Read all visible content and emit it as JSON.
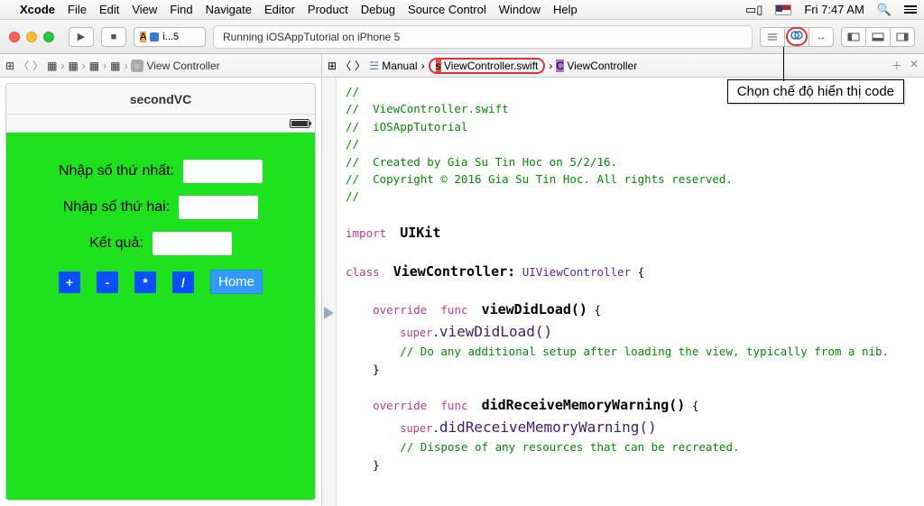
{
  "menubar": {
    "app": "Xcode",
    "items": [
      "File",
      "Edit",
      "View",
      "Find",
      "Navigate",
      "Editor",
      "Product",
      "Debug",
      "Source Control",
      "Window",
      "Help"
    ],
    "time": "Fri 7:47 AM"
  },
  "toolbar": {
    "scheme": "i...5",
    "status": "Running iOSAppTutorial on iPhone 5"
  },
  "left_jump": {
    "item": "View Controller"
  },
  "editor_jump": {
    "mode": "Manual",
    "file": "ViewController.swift",
    "class": "ViewController"
  },
  "phone": {
    "title": "secondVC",
    "label1": "Nhập số thứ nhất:",
    "label2": "Nhập số thứ hai:",
    "label3": "Kết quả:",
    "btn_plus": "+",
    "btn_minus": "-",
    "btn_mul": "*",
    "btn_div": "/",
    "btn_home": "Home"
  },
  "code": {
    "c1": "//",
    "c2": "//  ViewController.swift",
    "c3": "//  iOSAppTutorial",
    "c4": "//",
    "c5": "//  Created by Gia Su Tin Hoc on 5/2/16.",
    "c6": "//  Copyright © 2016 Gia Su Tin Hoc. All rights reserved.",
    "c7": "//",
    "import_kw": "import",
    "import_mod": "UIKit",
    "class_kw": "class",
    "class_name": "ViewController:",
    "class_super": "UIViewController",
    "override_kw": "override",
    "func_kw": "func",
    "vdl": "viewDidLoad()",
    "super_kw": "super",
    "vdl_call": "viewDidLoad()",
    "vdl_comment": "// Do any additional setup after loading the view, typically from a nib.",
    "drmw": "didReceiveMemoryWarning()",
    "drmw_call": "didReceiveMemoryWarning()",
    "drmw_comment": "// Dispose of any resources that can be recreated."
  },
  "annotation": "Chọn chế độ hiển thị code"
}
